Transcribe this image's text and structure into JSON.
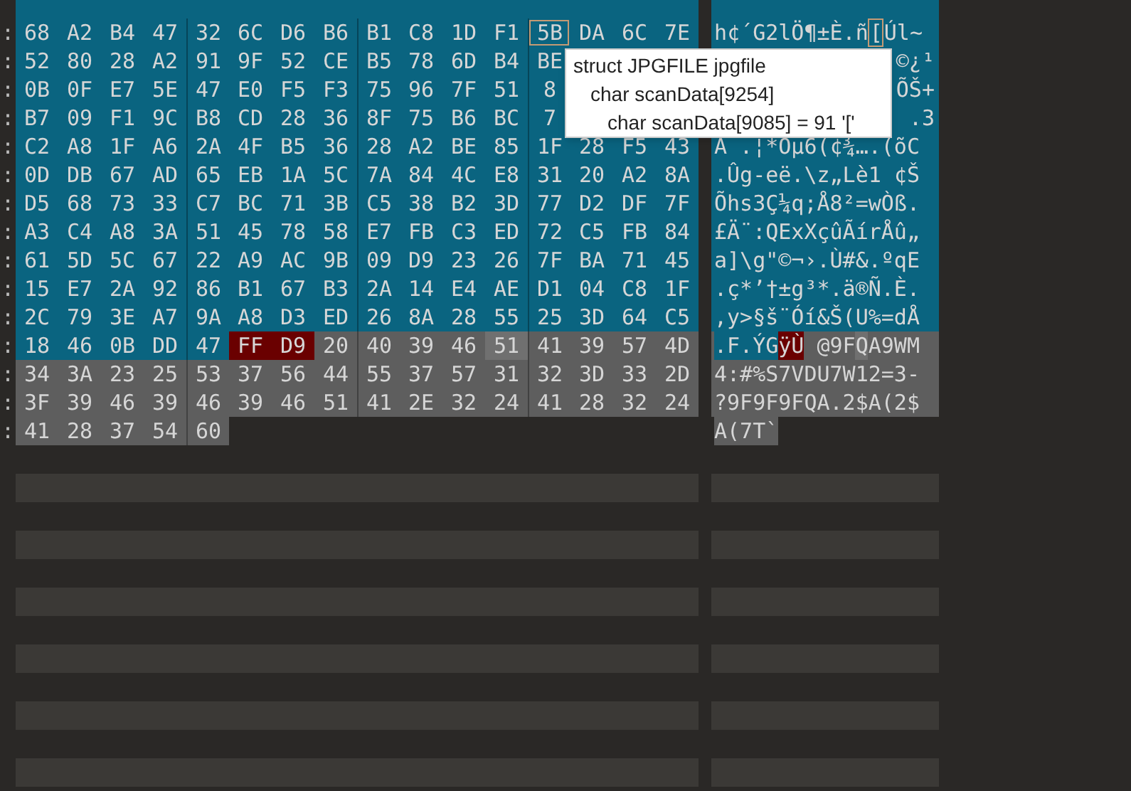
{
  "rows": [
    {
      "address_tail": ":",
      "segments": [
        {
          "kind": "struct",
          "bytes": [
            "68",
            "A2",
            "B4",
            "47",
            "32",
            "6C",
            "D6",
            "B6",
            "B1",
            "C8",
            "1D",
            "F1"
          ],
          "text": "h¢´G2lÖ¶±È.ñ"
        },
        {
          "kind": "cursor",
          "bytes": [
            "5B"
          ],
          "text": "["
        },
        {
          "kind": "struct",
          "bytes": [
            "DA",
            "6C",
            "7E"
          ],
          "text": "Úl~"
        }
      ]
    },
    {
      "address_tail": ":",
      "cut_by_tooltip": true,
      "segments": [
        {
          "kind": "struct",
          "bytes": [
            "52",
            "80",
            "28",
            "A2",
            "91",
            "9F",
            "52",
            "CE",
            "B5",
            "78",
            "6D",
            "B4",
            "BE"
          ],
          "text": "©¿¹"
        }
      ]
    },
    {
      "address_tail": ":",
      "cut_by_tooltip": true,
      "segments": [
        {
          "kind": "struct",
          "bytes": [
            "0B",
            "0F",
            "E7",
            "5E",
            "47",
            "E0",
            "F5",
            "F3",
            "75",
            "96",
            "7F",
            "51",
            "8"
          ],
          "text": "ÕŠ+"
        }
      ]
    },
    {
      "address_tail": ":",
      "cut_by_tooltip": true,
      "segments": [
        {
          "kind": "struct",
          "bytes": [
            "B7",
            "09",
            "F1",
            "9C",
            "B8",
            "CD",
            "28",
            "36",
            "8F",
            "75",
            "B6",
            "BC",
            "7"
          ],
          "text": ".3"
        }
      ]
    },
    {
      "address_tail": ":",
      "segments": [
        {
          "kind": "struct",
          "bytes": [
            "C2",
            "A8",
            "1F",
            "A6",
            "2A",
            "4F",
            "B5",
            "36",
            "28",
            "A2",
            "BE",
            "85",
            "1F",
            "28",
            "F5",
            "43"
          ],
          "text": "Â .¦*Oµ6(¢¾….(õC"
        }
      ]
    },
    {
      "address_tail": ":",
      "segments": [
        {
          "kind": "struct",
          "bytes": [
            "0D",
            "DB",
            "67",
            "AD",
            "65",
            "EB",
            "1A",
            "5C",
            "7A",
            "84",
            "4C",
            "E8",
            "31",
            "20",
            "A2",
            "8A"
          ],
          "text": ".Ûg-eë.\\z„Lè1 ¢Š"
        }
      ]
    },
    {
      "address_tail": ":",
      "segments": [
        {
          "kind": "struct",
          "bytes": [
            "D5",
            "68",
            "73",
            "33",
            "C7",
            "BC",
            "71",
            "3B",
            "C5",
            "38",
            "B2",
            "3D",
            "77",
            "D2",
            "DF",
            "7F"
          ],
          "text": "Õhs3Ç¼q;Å8²=wÒß."
        }
      ]
    },
    {
      "address_tail": ":",
      "segments": [
        {
          "kind": "struct",
          "bytes": [
            "A3",
            "C4",
            "A8",
            "3A",
            "51",
            "45",
            "78",
            "58",
            "E7",
            "FB",
            "C3",
            "ED",
            "72",
            "C5",
            "FB",
            "84"
          ],
          "text": "£Ä¨:QExXçûÃírÅû„"
        }
      ]
    },
    {
      "address_tail": ":",
      "segments": [
        {
          "kind": "struct",
          "bytes": [
            "61",
            "5D",
            "5C",
            "67",
            "22",
            "A9",
            "AC",
            "9B",
            "09",
            "D9",
            "23",
            "26",
            "7F",
            "BA",
            "71",
            "45"
          ],
          "text": "a]\\g\"©¬›.Ù#&.ºqE"
        }
      ]
    },
    {
      "address_tail": ":",
      "segments": [
        {
          "kind": "struct",
          "bytes": [
            "15",
            "E7",
            "2A",
            "92",
            "86",
            "B1",
            "67",
            "B3",
            "2A",
            "14",
            "E4",
            "AE",
            "D1",
            "04",
            "C8",
            "1F"
          ],
          "text": ".ç*’†±g³*.ä®Ñ.È."
        }
      ]
    },
    {
      "address_tail": ":",
      "segments": [
        {
          "kind": "struct",
          "bytes": [
            "2C",
            "79",
            "3E",
            "A7",
            "9A",
            "A8",
            "D3",
            "ED",
            "26",
            "8A",
            "28",
            "55",
            "25",
            "3D",
            "64",
            "C5"
          ],
          "text": ",y>§š¨Óí&Š(U%=dÅ"
        }
      ]
    },
    {
      "address_tail": ":",
      "segments": [
        {
          "kind": "struct",
          "bytes": [
            "18",
            "46",
            "0B",
            "DD",
            "47"
          ],
          "text": ".F.ÝG"
        },
        {
          "kind": "selected",
          "bytes": [
            "FF",
            "D9"
          ],
          "text": "ÿÙ"
        },
        {
          "kind": "after",
          "bytes": [
            "20",
            "40",
            "39",
            "46"
          ],
          "text": " @9F"
        },
        {
          "kind": "hover",
          "bytes": [
            "51"
          ],
          "text": "Q"
        },
        {
          "kind": "after",
          "bytes": [
            "41",
            "39",
            "57",
            "4D"
          ],
          "text": "A9WM"
        }
      ]
    },
    {
      "address_tail": ":",
      "segments": [
        {
          "kind": "after",
          "bytes": [
            "34",
            "3A",
            "23",
            "25",
            "53",
            "37",
            "56",
            "44",
            "55",
            "37",
            "57",
            "31",
            "32",
            "3D",
            "33",
            "2D"
          ],
          "text": "4:#%S7VDU7W12=3-"
        }
      ]
    },
    {
      "address_tail": ":",
      "segments": [
        {
          "kind": "after",
          "bytes": [
            "3F",
            "39",
            "46",
            "39",
            "46",
            "39",
            "46",
            "51",
            "41",
            "2E",
            "32",
            "24",
            "41",
            "28",
            "32",
            "24"
          ],
          "text": "?9F9F9FQA.2$A(2$"
        }
      ]
    },
    {
      "address_tail": ":",
      "segments": [
        {
          "kind": "after",
          "bytes": [
            "41",
            "28",
            "37",
            "54",
            "60"
          ],
          "text": "A(7T`"
        }
      ]
    }
  ],
  "tooltip": {
    "label": "struct JPGFILE jpgfile",
    "children": [
      {
        "label": "char scanData[9254]",
        "children": [
          {
            "label": "char scanData[9085] = 91 '['"
          }
        ]
      }
    ]
  }
}
